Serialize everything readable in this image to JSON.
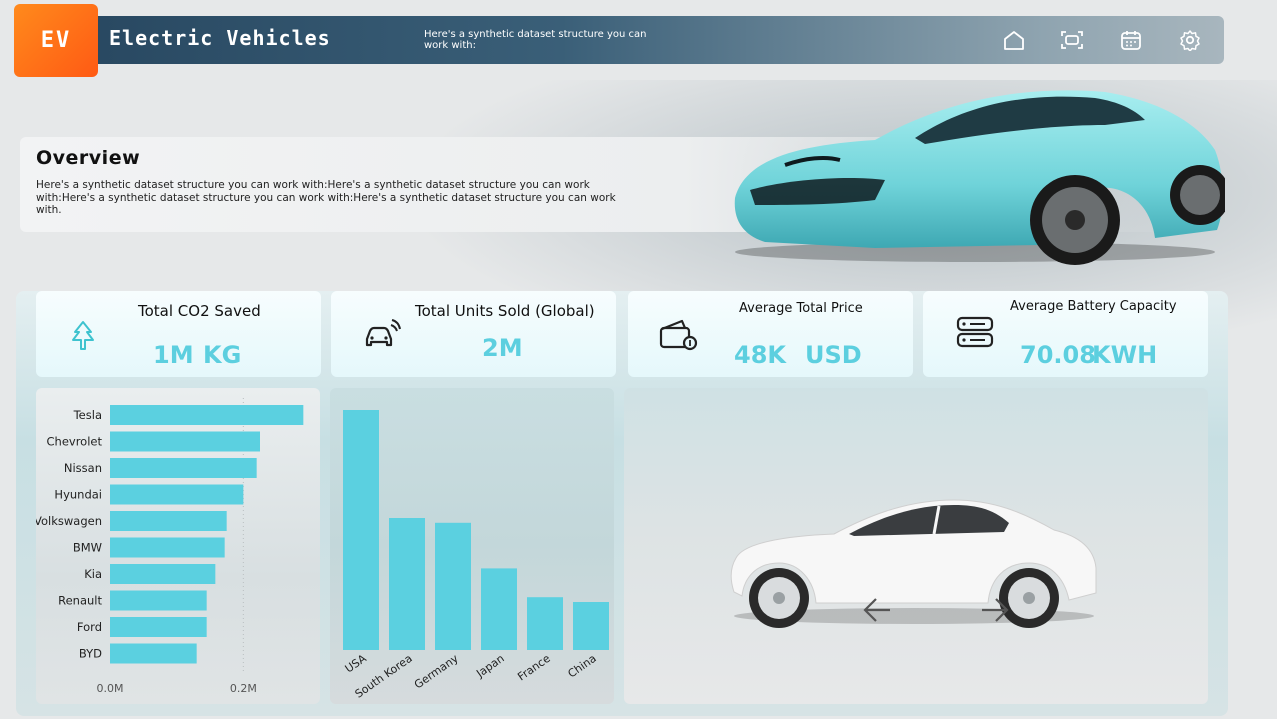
{
  "header": {
    "logo_text": "EV",
    "title": "Electric Vehicles",
    "subtitle": "Here's a synthetic dataset structure you can work with:",
    "icons": [
      "home-icon",
      "scan-icon",
      "calendar-icon",
      "gear-icon"
    ]
  },
  "overview": {
    "title": "Overview",
    "text": "Here's a synthetic dataset structure you can work with:Here's a synthetic dataset structure you can work with:Here's a synthetic dataset structure you can work with:Here's a synthetic dataset structure you can work with."
  },
  "kpis": {
    "co2": {
      "title": "Total CO2 Saved",
      "value": "1M",
      "unit": "KG",
      "icon": "tree-icon"
    },
    "units": {
      "title": "Total Units Sold (Global)",
      "value": "2M",
      "icon": "connected-car-icon"
    },
    "price": {
      "title": "Average Total Price",
      "value": "48K",
      "unit": "USD",
      "icon": "wallet-icon"
    },
    "battery": {
      "title": "Average Battery Capacity",
      "value": "70.08",
      "unit": "KWH",
      "icon": "server-icon"
    }
  },
  "colors": {
    "accent": "#5ccfdf",
    "bar": "#5bd0e0",
    "logo": "#ff6a18"
  },
  "chart_data": [
    {
      "type": "bar",
      "orientation": "horizontal",
      "categories": [
        "Tesla",
        "Chevrolet",
        "Nissan",
        "Hyundai",
        "Volkswagen",
        "BMW",
        "Kia",
        "Renault",
        "Ford",
        "BYD"
      ],
      "values": [
        0.29,
        0.225,
        0.22,
        0.2,
        0.175,
        0.172,
        0.158,
        0.145,
        0.145,
        0.13
      ],
      "unit": "M",
      "xticks": [
        "0.0M",
        "0.2M"
      ],
      "xlim": [
        0,
        0.3
      ]
    },
    {
      "type": "bar",
      "orientation": "vertical",
      "categories": [
        "USA",
        "South Korea",
        "Germany",
        "Japan",
        "France",
        "China"
      ],
      "values": [
        100,
        55,
        53,
        34,
        22,
        20
      ],
      "ylim": [
        0,
        100
      ]
    }
  ],
  "carousel": {
    "prev_icon": "chevron-left-icon",
    "next_icon": "chevron-right-icon"
  }
}
